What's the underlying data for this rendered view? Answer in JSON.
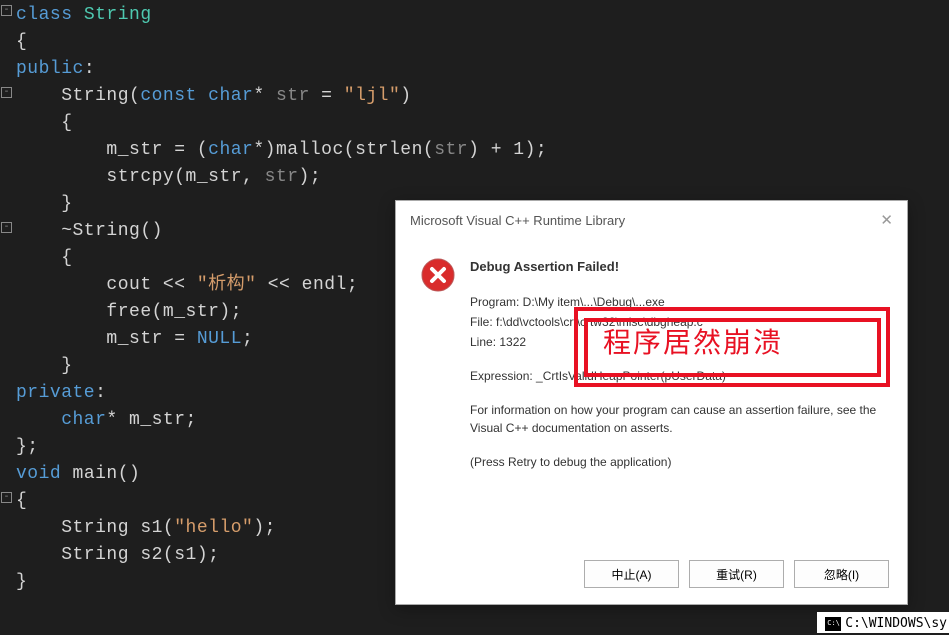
{
  "code": {
    "line1_a": "class",
    "line1_b": " String",
    "line2": "{",
    "line3a": "public",
    "line3b": ":",
    "line4_a": "    String(",
    "line4_b": "const",
    "line4_c": " char",
    "line4_d": "* ",
    "line4_e": "str",
    "line4_f": " = ",
    "line4_g": "\"ljl\"",
    "line4_h": ")",
    "line5": "    {",
    "line6_a": "        m_str = (",
    "line6_b": "char",
    "line6_c": "*)malloc(strlen(",
    "line6_d": "str",
    "line6_e": ") + 1);",
    "line7_a": "        strcpy(m_str, ",
    "line7_b": "str",
    "line7_c": ");",
    "line8": "    }",
    "line9_a": "    ~String()",
    "line10": "    {",
    "line11_a": "        cout << ",
    "line11_b": "\"析构\"",
    "line11_c": " << endl;",
    "line12": "        free(m_str);",
    "line13_a": "        m_str = ",
    "line13_b": "NULL",
    "line13_c": ";",
    "line14": "    }",
    "line15a": "private",
    "line15b": ":",
    "line16_a": "    char",
    "line16_b": "* m_str;",
    "line17": "};",
    "line18_a": "void",
    "line18_b": " main()",
    "line19": "{",
    "line20_a": "    String s1(",
    "line20_b": "\"hello\"",
    "line20_c": ");",
    "line21": "    String s2(s1);",
    "line22": "}"
  },
  "dialog": {
    "title": "Microsoft Visual C++ Runtime Library",
    "heading": "Debug Assertion Failed!",
    "program": "Program: D:\\My item\\...\\Debug\\...exe",
    "file": "File: f:\\dd\\vctools\\crt\\crtw32\\misc\\dbgheap.c",
    "line": "Line: 1322",
    "expression": "Expression: _CrtIsValidHeapPointer(pUserData)",
    "info1": "For information on how your program can cause an assertion failure, see the Visual C++ documentation on asserts.",
    "info2": "(Press Retry to debug the application)",
    "btn_abort": "中止(A)",
    "btn_retry": "重试(R)",
    "btn_ignore": "忽略(I)"
  },
  "annotation": {
    "text": "程序居然崩溃"
  },
  "taskbar": {
    "text": "C:\\WINDOWS\\sy"
  }
}
